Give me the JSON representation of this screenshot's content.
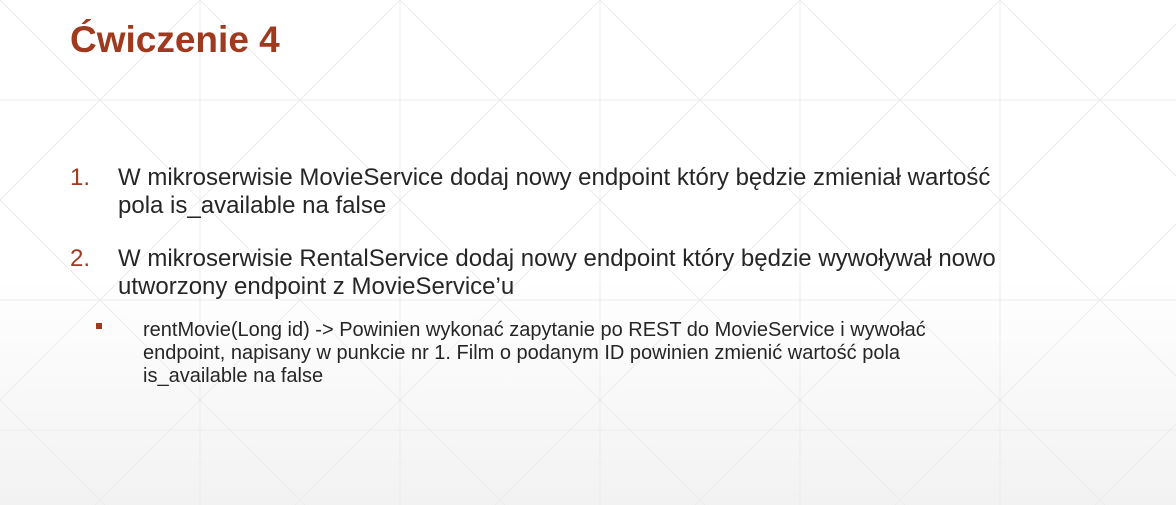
{
  "slide": {
    "title": "Ćwiczenie 4",
    "items": [
      {
        "number": "1.",
        "lines": [
          "W mikroserwisie MovieService dodaj nowy endpoint który będzie zmieniał wartość",
          "pola is_available na false"
        ]
      },
      {
        "number": "2.",
        "lines": [
          "W mikroserwisie RentalService dodaj nowy endpoint który będzie wywoływał nowo",
          "utworzony endpoint z MovieService’u"
        ]
      }
    ],
    "sub_item": {
      "lines": [
        "rentMovie(Long id) -> Powinien wykonać zapytanie po REST do MovieService i wywołać",
        "endpoint, napisany w punkcie nr 1. Film o podanym ID powinien zmienić wartość pola",
        "is_available na false"
      ]
    }
  },
  "colors": {
    "accent": "#9f3a1e",
    "text": "#262626",
    "pattern": "#e9e9e9"
  }
}
